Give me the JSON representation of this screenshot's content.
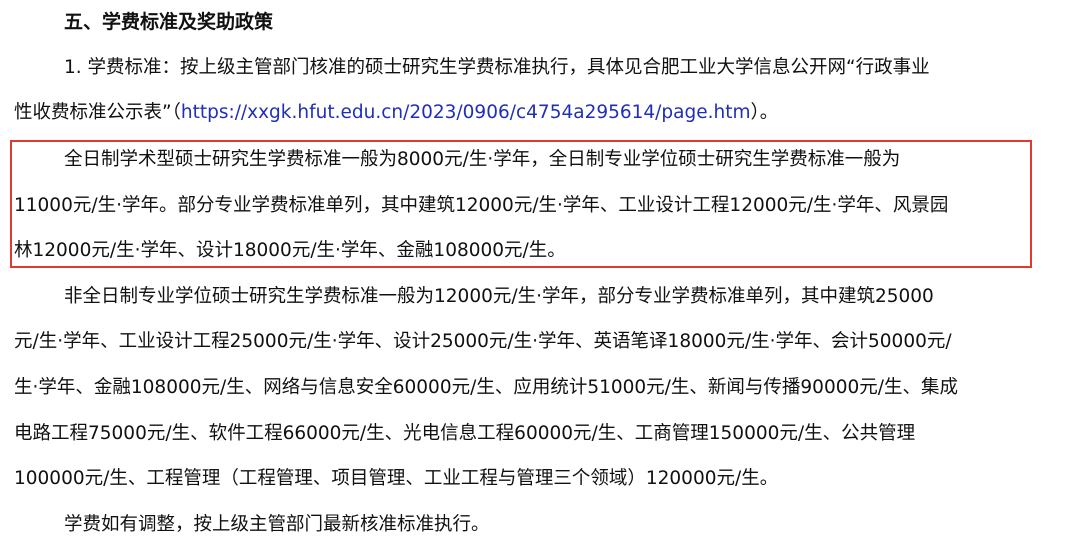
{
  "section": {
    "heading": "五、学费标准及奖助政策"
  },
  "paragraph1": {
    "line1": "1. 学费标准：按上级主管部门核准的硕士研究生学费标准执行，具体见合肥工业大学信息公开网“行政事业",
    "line2_prefix": "性收费标准公示表”（",
    "line2_link": "https://xxgk.hfut.edu.cn/2023/0906/c4754a295614/page.htm",
    "line2_suffix": "）。"
  },
  "paragraph2": {
    "line1": "全日制学术型硕士研究生学费标准一般为8000元/生·学年，全日制专业学位硕士研究生学费标准一般为",
    "line2": "11000元/生·学年。部分专业学费标准单列，其中建筑12000元/生·学年、工业设计工程12000元/生·学年、风景园",
    "line3": "林12000元/生·学年、设计18000元/生·学年、金融108000元/生。"
  },
  "paragraph3": {
    "line1": "非全日制专业学位硕士研究生学费标准一般为12000元/生·学年，部分专业学费标准单列，其中建筑25000",
    "line2": "元/生·学年、工业设计工程25000元/生·学年、设计25000元/生·学年、英语笔译18000元/生·学年、会计50000元/",
    "line3": "生·学年、金融108000元/生、网络与信息安全60000元/生、应用统计51000元/生、新闻与传播90000元/生、集成",
    "line4": "电路工程75000元/生、软件工程66000元/生、光电信息工程60000元/生、工商管理150000元/生、公共管理",
    "line5": "100000元/生、工程管理（工程管理、项目管理、工业工程与管理三个领域）120000元/生。"
  },
  "paragraph4": {
    "line1": "学费如有调整，按上级主管部门最新核准标准执行。"
  },
  "colors": {
    "text": "#111111",
    "link": "#1f2fb8",
    "highlight_border": "#e03a2c"
  }
}
